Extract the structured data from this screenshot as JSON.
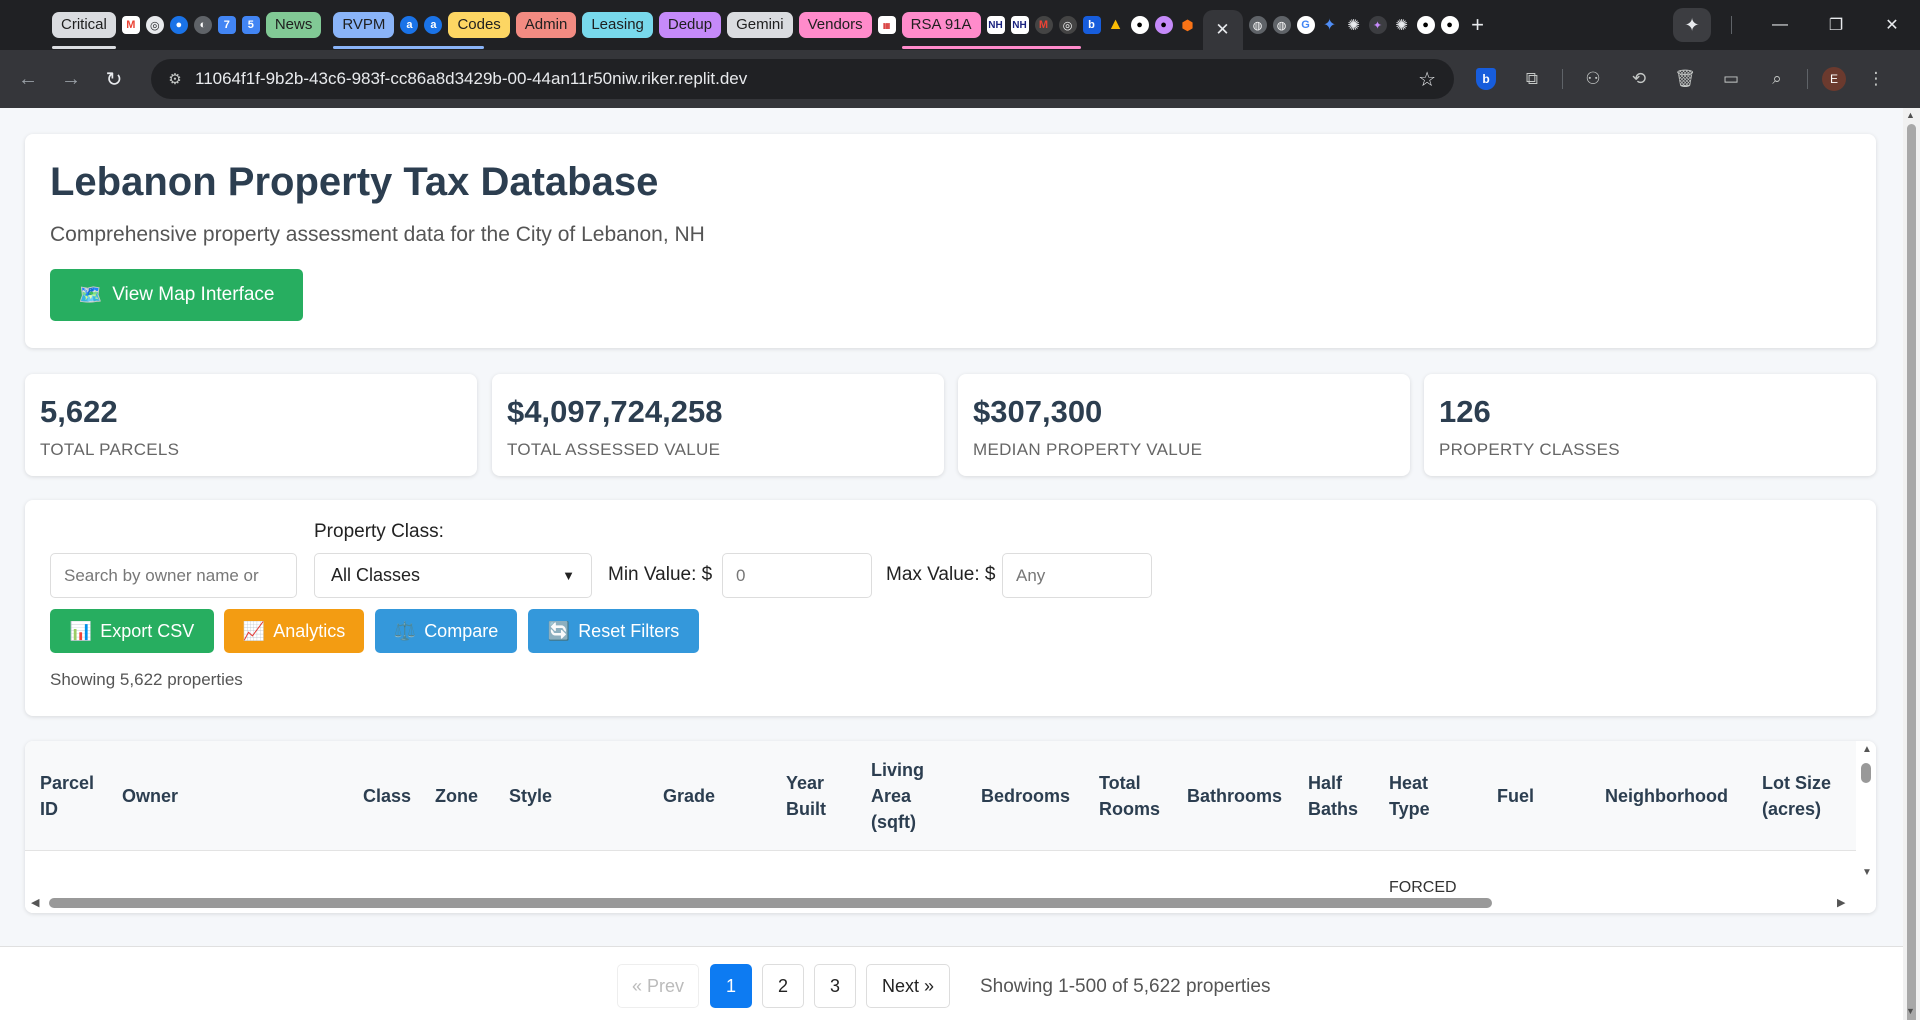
{
  "browser": {
    "tab_groups": [
      {
        "label": "Critical",
        "bg": "#dadce0",
        "fg": "#202124",
        "underline": "#dadce0"
      },
      {
        "label": "News",
        "bg": "#81c995",
        "fg": "#1f1f1f",
        "underline": ""
      },
      {
        "label": "RVPM",
        "bg": "#8ab4f8",
        "fg": "#1f1f1f",
        "underline": "#8ab4f8"
      },
      {
        "label": "Codes",
        "bg": "#fdd663",
        "fg": "#1f1f1f",
        "underline": ""
      },
      {
        "label": "Admin",
        "bg": "#f28b82",
        "fg": "#1f1f1f",
        "underline": ""
      },
      {
        "label": "Leasing",
        "bg": "#78d9ec",
        "fg": "#1f1f1f",
        "underline": ""
      },
      {
        "label": "Dedup",
        "bg": "#c58af9",
        "fg": "#1f1f1f",
        "underline": ""
      },
      {
        "label": "Gemini",
        "bg": "#dadce0",
        "fg": "#1f1f1f",
        "underline": ""
      },
      {
        "label": "Vendors",
        "bg": "#ff8bcb",
        "fg": "#1f1f1f",
        "underline": ""
      },
      {
        "label": "RSA 91A",
        "bg": "#ff8bcb",
        "fg": "#1f1f1f",
        "underline": "#ff8bcb"
      }
    ],
    "url": "11064f1f-9b2b-43c6-983f-cc86a8d3429b-00-44an11r50niw.riker.replit.dev",
    "profile_initial": "E"
  },
  "header": {
    "title": "Lebanon Property Tax Database",
    "subtitle": "Comprehensive property assessment data for the City of Lebanon, NH",
    "map_button_icon": "🗺️",
    "map_button_label": "View Map Interface"
  },
  "stats": [
    {
      "value": "5,622",
      "label": "TOTAL PARCELS"
    },
    {
      "value": "$4,097,724,258",
      "label": "TOTAL ASSESSED VALUE"
    },
    {
      "value": "$307,300",
      "label": "MEDIAN PROPERTY VALUE"
    },
    {
      "value": "126",
      "label": "PROPERTY CLASSES"
    }
  ],
  "filters": {
    "search_placeholder": "Search by owner name or",
    "property_class_label": "Property Class:",
    "property_class_value": "All Classes",
    "min_value_label": "Min Value: $",
    "min_value_placeholder": "0",
    "max_value_label": "Max Value: $",
    "max_value_placeholder": "Any",
    "buttons": {
      "export_icon": "📊",
      "export_label": "Export CSV",
      "analytics_icon": "📈",
      "analytics_label": "Analytics",
      "compare_icon": "⚖️",
      "compare_label": "Compare",
      "reset_icon": "🔄",
      "reset_label": "Reset Filters"
    },
    "showing_text": "Showing 5,622 properties"
  },
  "table": {
    "columns": [
      "Parcel ID",
      "Owner",
      "Class",
      "Zone",
      "Style",
      "Grade",
      "Year Built",
      "Living Area (sqft)",
      "Bedrooms",
      "Total Rooms",
      "Bathrooms",
      "Half Baths",
      "Heat Type",
      "Fuel",
      "Neighborhood",
      "Lot Size (acres)"
    ],
    "first_row_peek": "FORCED"
  },
  "pagination": {
    "prev_label": "« Prev",
    "pages": [
      "1",
      "2",
      "3"
    ],
    "active_page": "1",
    "next_label": "Next »",
    "info": "Showing 1-500 of 5,622 properties"
  }
}
